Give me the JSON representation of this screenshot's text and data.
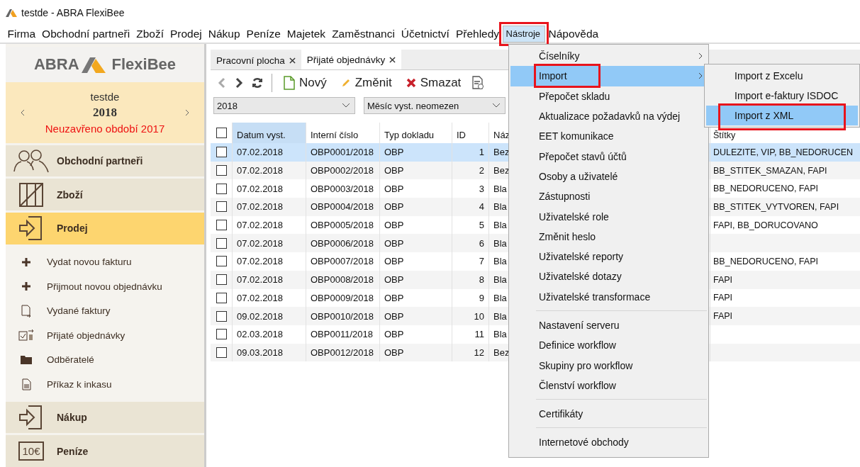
{
  "window": {
    "title": "testde - ABRA FlexiBee"
  },
  "menu_bar": [
    {
      "label": "Firma",
      "selected": false,
      "annotated": false
    },
    {
      "label": "Obchodní partneři",
      "selected": false,
      "annotated": false
    },
    {
      "label": "Zboží",
      "selected": false,
      "annotated": false
    },
    {
      "label": "Prodej",
      "selected": false,
      "annotated": false
    },
    {
      "label": "Nákup",
      "selected": false,
      "annotated": false
    },
    {
      "label": "Peníze",
      "selected": false,
      "annotated": false
    },
    {
      "label": "Majetek",
      "selected": false,
      "annotated": false
    },
    {
      "label": "Zaměstnanci",
      "selected": false,
      "annotated": false
    },
    {
      "label": "Účetnictví",
      "selected": false,
      "annotated": false
    },
    {
      "label": "Přehledy",
      "selected": false,
      "annotated": false
    },
    {
      "label": "Nástroje",
      "selected": true,
      "annotated": true
    },
    {
      "label": "Nápověda",
      "selected": false,
      "annotated": false
    }
  ],
  "sidebar": {
    "logo_left": "ABRA",
    "logo_right": "FlexiBee",
    "company": "testde",
    "year": "2018",
    "period_note": "Neuzavřeno období 2017",
    "sections": [
      {
        "label": "Obchodní partneři",
        "selected": false
      },
      {
        "label": "Zboží",
        "selected": false
      },
      {
        "label": "Prodej",
        "selected": true,
        "children": [
          {
            "label": "Vydat novou fakturu"
          },
          {
            "label": "Přijmout novou objednávku"
          },
          {
            "label": "Vydané faktury"
          },
          {
            "label": "Přijaté objednávky"
          },
          {
            "label": "Odběratelé"
          },
          {
            "label": "Příkaz k inkasu"
          }
        ]
      },
      {
        "label": "Nákup",
        "selected": false
      },
      {
        "label": "Peníze",
        "selected": false,
        "badge": "10€"
      }
    ]
  },
  "tabs": [
    {
      "label": "Pracovní plocha",
      "selected": false
    },
    {
      "label": "Přijaté objednávky",
      "selected": true
    }
  ],
  "toolbar": {
    "nav": [
      {
        "kind": "back",
        "disabled": true
      },
      {
        "kind": "forward",
        "disabled": false
      },
      {
        "kind": "refresh",
        "disabled": false
      }
    ],
    "buttons": [
      {
        "kind": "new",
        "label": "Nový"
      },
      {
        "kind": "edit",
        "label": "Změnit"
      },
      {
        "kind": "delete",
        "label": "Smazat"
      },
      {
        "kind": "document"
      }
    ]
  },
  "filters": [
    {
      "value": "2018"
    },
    {
      "value": "Měsíc vyst. neomezen"
    }
  ],
  "table": {
    "all_checked": false,
    "columns": [
      {
        "label": "Datum vyst.",
        "sorted": true
      },
      {
        "label": "Interní číslo",
        "sorted": false
      },
      {
        "label": "Typ dokladu",
        "sorted": false
      },
      {
        "label": "ID",
        "sorted": false
      },
      {
        "label": "Náz",
        "sorted": false
      },
      {
        "label": "Štítky",
        "sorted": false
      }
    ],
    "rows": [
      {
        "checked": false,
        "selected": true,
        "cells": [
          "07.02.2018",
          "OBP0001/2018",
          "OBP",
          "1",
          "Bez",
          "DULEZITE, VIP, BB_NEDORUCEN"
        ]
      },
      {
        "checked": false,
        "selected": false,
        "cells": [
          "07.02.2018",
          "OBP0002/2018",
          "OBP",
          "2",
          "Bez",
          "BB_STITEK_SMAZAN, FAPI"
        ]
      },
      {
        "checked": false,
        "selected": false,
        "cells": [
          "07.02.2018",
          "OBP0003/2018",
          "OBP",
          "3",
          "Bla",
          "BB_NEDORUCENO, FAPI"
        ]
      },
      {
        "checked": false,
        "selected": false,
        "cells": [
          "07.02.2018",
          "OBP0004/2018",
          "OBP",
          "4",
          "Bla",
          "BB_STITEK_VYTVOREN, FAPI"
        ]
      },
      {
        "checked": false,
        "selected": false,
        "cells": [
          "07.02.2018",
          "OBP0005/2018",
          "OBP",
          "5",
          "Bla",
          "FAPI, BB_DORUCOVANO"
        ]
      },
      {
        "checked": false,
        "selected": false,
        "cells": [
          "07.02.2018",
          "OBP0006/2018",
          "OBP",
          "6",
          "Bla",
          ""
        ]
      },
      {
        "checked": false,
        "selected": false,
        "cells": [
          "07.02.2018",
          "OBP0007/2018",
          "OBP",
          "7",
          "Bla",
          "BB_NEDORUCENO, FAPI"
        ]
      },
      {
        "checked": false,
        "selected": false,
        "cells": [
          "07.02.2018",
          "OBP0008/2018",
          "OBP",
          "8",
          "Bla",
          "FAPI"
        ]
      },
      {
        "checked": false,
        "selected": false,
        "cells": [
          "07.02.2018",
          "OBP0009/2018",
          "OBP",
          "9",
          "Bla",
          "FAPI"
        ]
      },
      {
        "checked": false,
        "selected": false,
        "cells": [
          "09.02.2018",
          "OBP0010/2018",
          "OBP",
          "10",
          "Bla",
          "FAPI"
        ]
      },
      {
        "checked": false,
        "selected": false,
        "cells": [
          "02.03.2018",
          "OBP0011/2018",
          "OBP",
          "11",
          "Bla",
          ""
        ]
      },
      {
        "checked": false,
        "selected": false,
        "cells": [
          "09.03.2018",
          "OBP0012/2018",
          "OBP",
          "12",
          "Bez",
          ""
        ]
      }
    ]
  },
  "menu": {
    "items": [
      {
        "kind": "item",
        "label": "Číselníky",
        "submenu": true,
        "selected": false,
        "annotated": false
      },
      {
        "kind": "item",
        "label": "Import",
        "submenu": true,
        "selected": true,
        "annotated": true
      },
      {
        "kind": "item",
        "label": "Přepočet skladu",
        "submenu": false,
        "selected": false,
        "annotated": false
      },
      {
        "kind": "item",
        "label": "Aktualizace požadavků na výdej",
        "submenu": false,
        "selected": false,
        "annotated": false
      },
      {
        "kind": "item",
        "label": "EET komunikace",
        "submenu": false,
        "selected": false,
        "annotated": false
      },
      {
        "kind": "item",
        "label": "Přepočet stavů účtů",
        "submenu": false,
        "selected": false,
        "annotated": false
      },
      {
        "kind": "item",
        "label": "Osoby a uživatelé",
        "submenu": false,
        "selected": false,
        "annotated": false
      },
      {
        "kind": "item",
        "label": "Zástupnosti",
        "submenu": false,
        "selected": false,
        "annotated": false
      },
      {
        "kind": "item",
        "label": "Uživatelské role",
        "submenu": false,
        "selected": false,
        "annotated": false
      },
      {
        "kind": "item",
        "label": "Změnit heslo",
        "submenu": false,
        "selected": false,
        "annotated": false
      },
      {
        "kind": "item",
        "label": "Uživatelské reporty",
        "submenu": false,
        "selected": false,
        "annotated": false
      },
      {
        "kind": "item",
        "label": "Uživatelské dotazy",
        "submenu": false,
        "selected": false,
        "annotated": false
      },
      {
        "kind": "item",
        "label": "Uživatelské transformace",
        "submenu": false,
        "selected": false,
        "annotated": false
      },
      {
        "kind": "separator"
      },
      {
        "kind": "item",
        "label": "Nastavení serveru",
        "submenu": false,
        "selected": false,
        "annotated": false
      },
      {
        "kind": "item",
        "label": "Definice workflow",
        "submenu": false,
        "selected": false,
        "annotated": false
      },
      {
        "kind": "item",
        "label": "Skupiny pro workflow",
        "submenu": false,
        "selected": false,
        "annotated": false
      },
      {
        "kind": "item",
        "label": "Členství workflow",
        "submenu": false,
        "selected": false,
        "annotated": false
      },
      {
        "kind": "separator"
      },
      {
        "kind": "item",
        "label": "Certifikáty",
        "submenu": false,
        "selected": false,
        "annotated": false
      },
      {
        "kind": "separator"
      },
      {
        "kind": "item",
        "label": "Internetové obchody",
        "submenu": false,
        "selected": false,
        "annotated": false
      }
    ]
  },
  "submenu": {
    "items": [
      {
        "label": "Import z Excelu",
        "selected": false,
        "annotated": false
      },
      {
        "label": "Import e-faktury ISDOC",
        "selected": false,
        "annotated": false
      },
      {
        "label": "Import z XML",
        "selected": true,
        "annotated": true
      }
    ]
  }
}
